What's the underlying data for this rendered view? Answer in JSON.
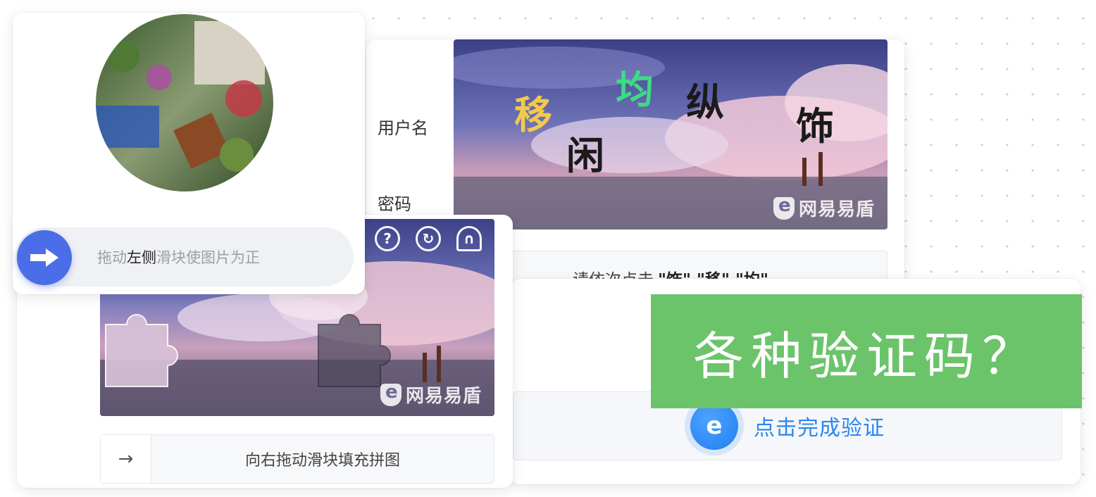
{
  "login": {
    "username_label": "用户名",
    "password_label": "密码",
    "password_mask": "●●●●●●",
    "click_chars": [
      {
        "char": "移",
        "color": "#f2c94c"
      },
      {
        "char": "均",
        "color": "#3ddc84"
      },
      {
        "char": "纵",
        "color": "#1a1a1a"
      },
      {
        "char": "闲",
        "color": "#1a1a1a"
      },
      {
        "char": "饰",
        "color": "#1a1a1a"
      }
    ],
    "click_prompt_prefix": "请依次点击",
    "click_prompt_targets": "\"饰\" \"移\" \"均\"",
    "brand": "网易易盾"
  },
  "verify": {
    "button_text": "点击完成验证",
    "shield_glyph": "e"
  },
  "puzzle": {
    "slider_text": "向右拖动滑块填充拼图",
    "handle_glyph": "→",
    "brand": "网易易盾",
    "icons": [
      "help-icon",
      "refresh-icon",
      "headphones-icon"
    ],
    "icon_glyphs": [
      "?",
      "↻",
      "∩"
    ]
  },
  "rotate": {
    "label_before": "拖动",
    "label_highlight": "左侧",
    "label_after": "滑块使图片为正"
  },
  "banner": {
    "title": "各种验证码？",
    "background": "#6bc46a"
  }
}
